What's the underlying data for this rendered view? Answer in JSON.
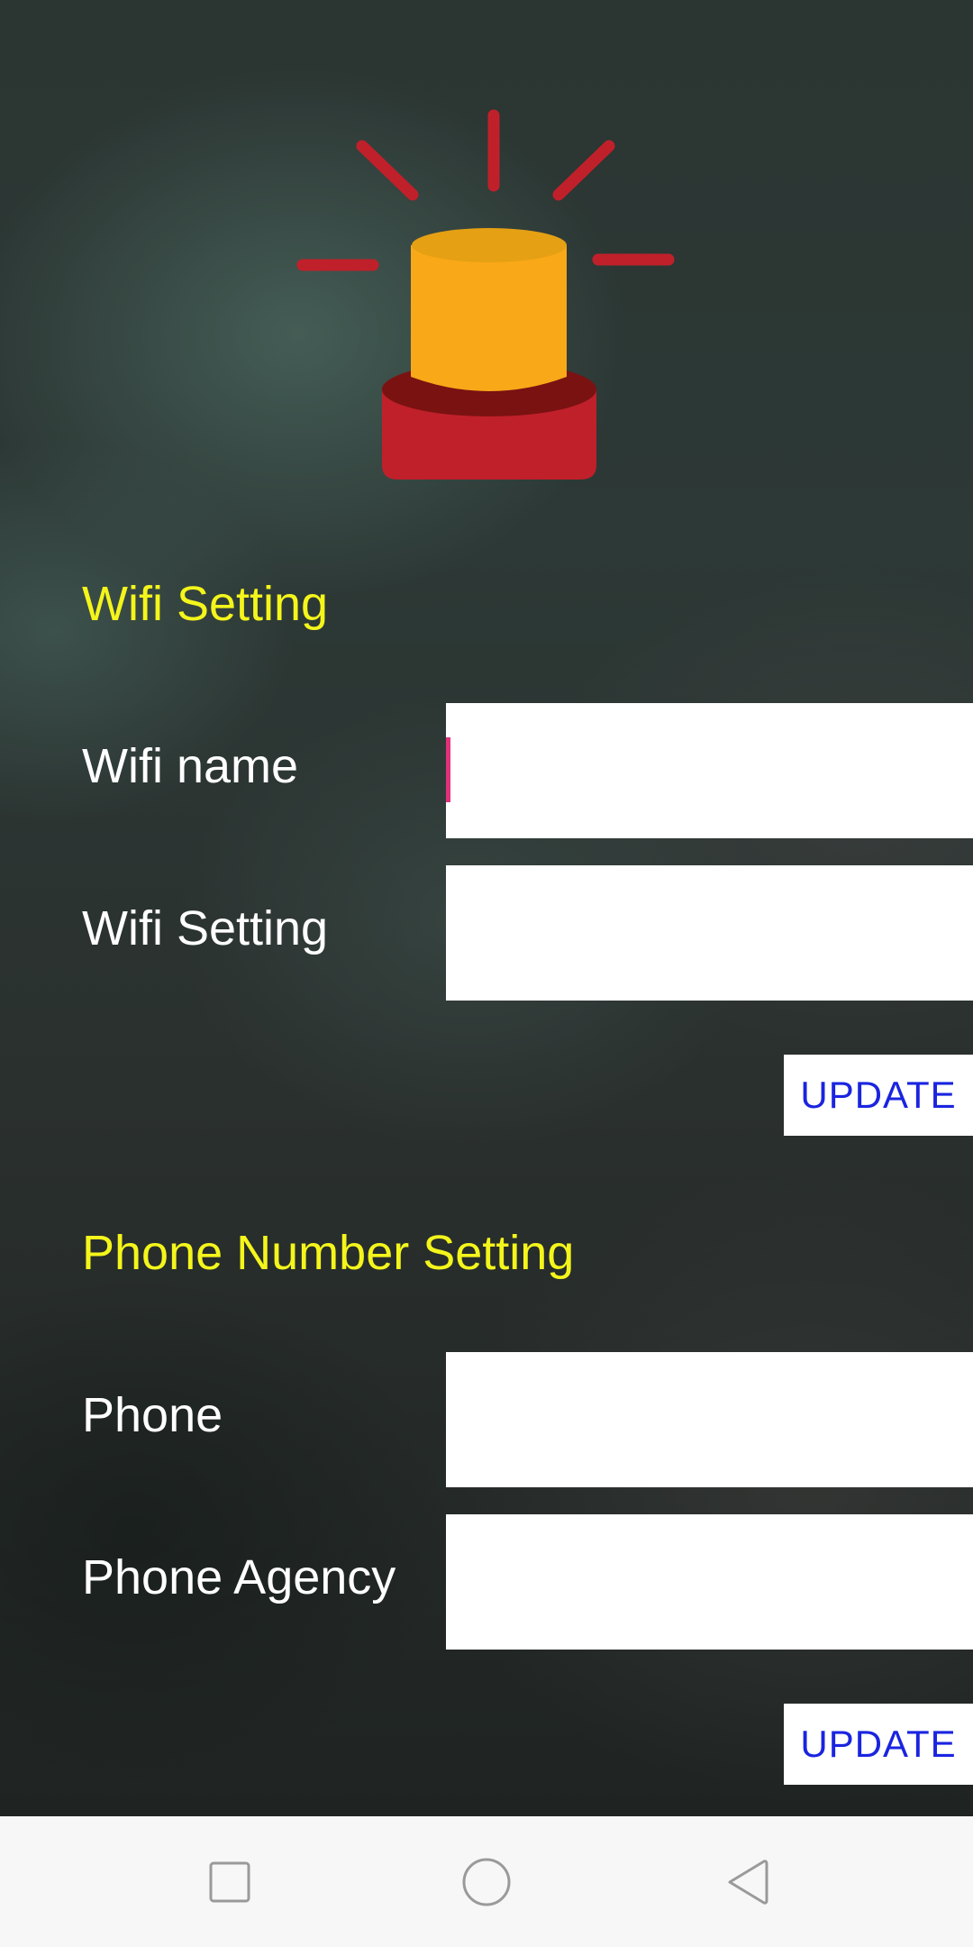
{
  "app": {
    "logo_icon": "alarm-siren-icon",
    "colors": {
      "section_title": "#f4f51b",
      "label": "#ffffff",
      "button_text": "#1a24e0",
      "cursor": "#e0317a",
      "siren_light": "#f9a818",
      "siren_base": "#c0202a",
      "siren_rays": "#c0202a"
    }
  },
  "wifi_section": {
    "title": "Wifi Setting",
    "fields": [
      {
        "label": "Wifi name",
        "value": "",
        "focused": true
      },
      {
        "label": "Wifi Setting",
        "value": ""
      }
    ],
    "update_label": "UPDATE"
  },
  "phone_section": {
    "title": "Phone Number Setting",
    "fields": [
      {
        "label": "Phone",
        "value": ""
      },
      {
        "label": "Phone Agency",
        "value": ""
      }
    ],
    "update_label": "UPDATE"
  },
  "navbar": {
    "recents_icon": "square-recents-icon",
    "home_icon": "circle-home-icon",
    "back_icon": "triangle-back-icon"
  }
}
